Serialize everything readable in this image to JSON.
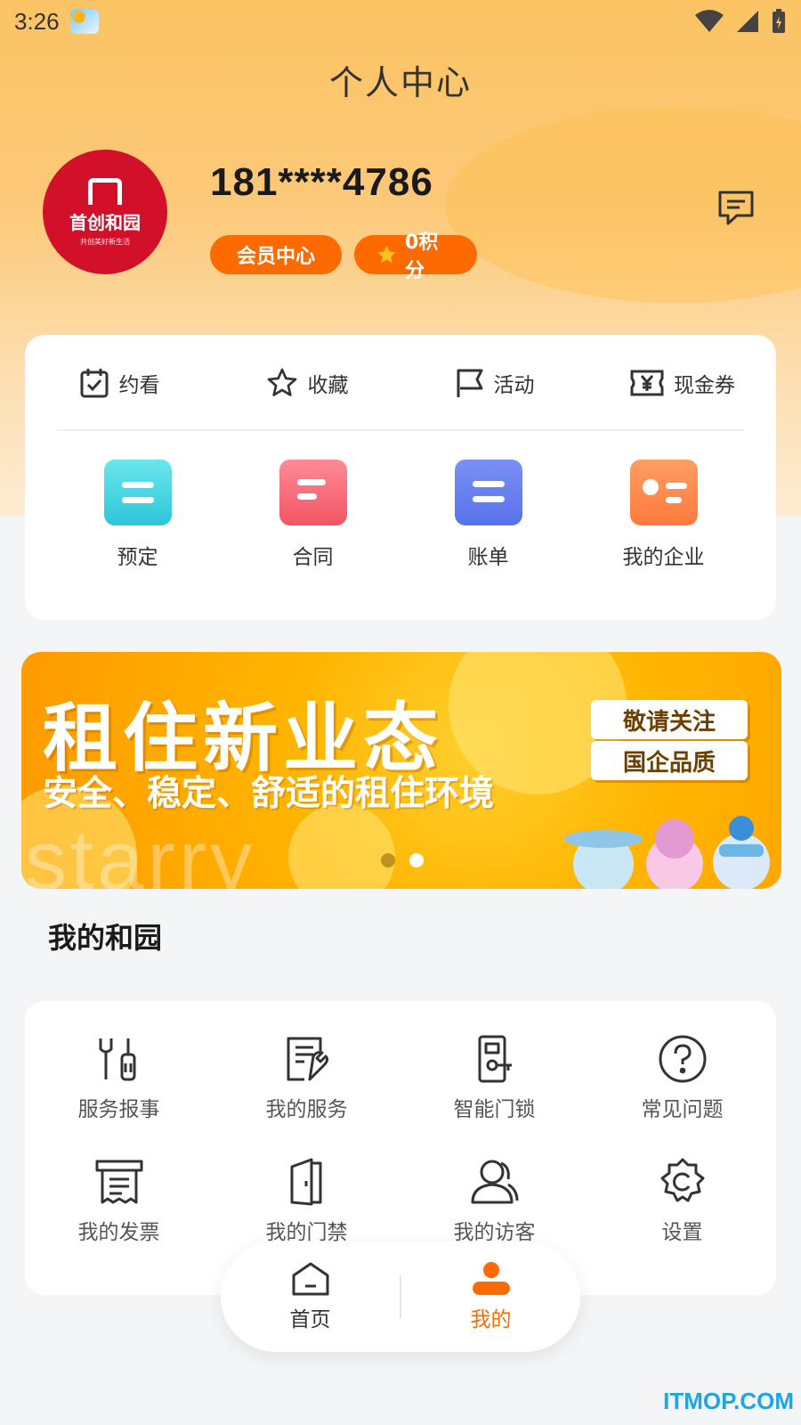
{
  "status_bar": {
    "time": "3:26"
  },
  "header": {
    "title": "个人中心"
  },
  "profile": {
    "avatar_brand": "首创和园",
    "avatar_slogan": "共创美好新生活",
    "phone": "181****4786",
    "member_label": "会员中心",
    "points_label": "0积分"
  },
  "quick_actions": [
    {
      "label": "约看",
      "icon": "calendar-check-icon"
    },
    {
      "label": "收藏",
      "icon": "star-icon"
    },
    {
      "label": "活动",
      "icon": "flag-icon"
    },
    {
      "label": "现金券",
      "icon": "coupon-icon"
    }
  ],
  "tiles": [
    {
      "label": "预定",
      "color": "#3fd4e0"
    },
    {
      "label": "合同",
      "color": "#ff6b7a"
    },
    {
      "label": "账单",
      "color": "#6b82f2"
    },
    {
      "label": "我的企业",
      "color": "#ff8a4c"
    }
  ],
  "banner": {
    "headline": "租住新业态",
    "subline": "安全、稳定、舒适的租住环境",
    "tag1": "敬请关注",
    "tag2": "国企品质",
    "watermark": "starry",
    "active_slide": 2,
    "slide_count": 2
  },
  "my_garden": {
    "title": "我的和园",
    "items": [
      {
        "label": "服务报事",
        "icon": "wrench-icon"
      },
      {
        "label": "我的服务",
        "icon": "service-doc-icon"
      },
      {
        "label": "智能门锁",
        "icon": "smart-lock-icon"
      },
      {
        "label": "常见问题",
        "icon": "question-icon"
      },
      {
        "label": "我的发票",
        "icon": "invoice-icon"
      },
      {
        "label": "我的门禁",
        "icon": "door-icon"
      },
      {
        "label": "我的访客",
        "icon": "visitor-icon"
      },
      {
        "label": "设置",
        "icon": "settings-icon"
      }
    ]
  },
  "bottom_nav": {
    "home_label": "首页",
    "mine_label": "我的",
    "active": "我的"
  },
  "watermark": "ITMOP.COM",
  "colors": {
    "accent": "#ff6a00",
    "header_bg": "#fbc363"
  }
}
